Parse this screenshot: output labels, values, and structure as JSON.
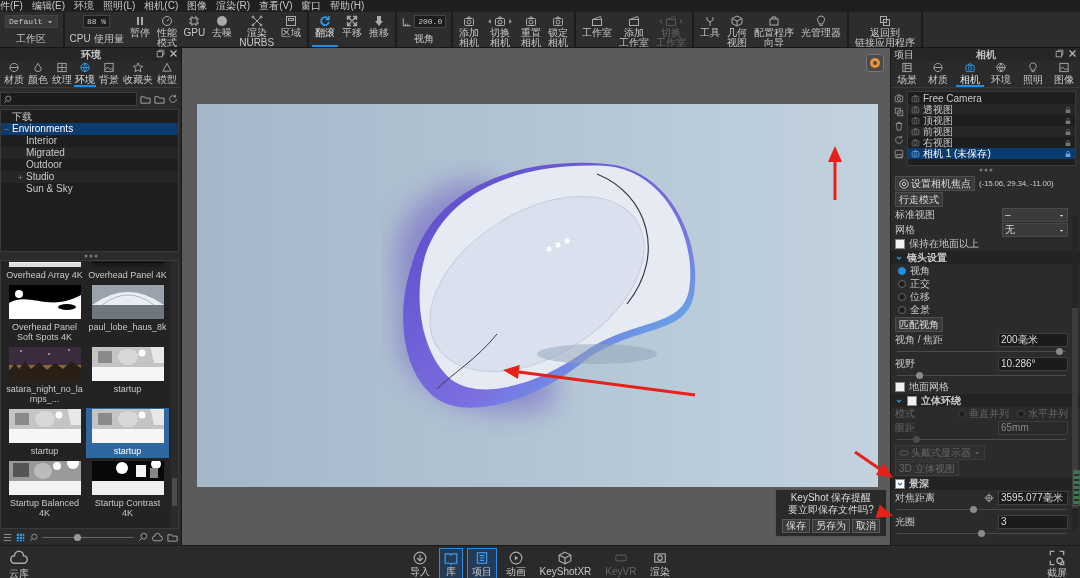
{
  "menu_bar": [
    "件(F)",
    "编辑(E)",
    "环境",
    "照明(L)",
    "相机(C)",
    "图像",
    "渲染(R)",
    "查看(V)",
    "窗口",
    "帮助(H)"
  ],
  "toolbar": {
    "groups": [
      [
        {
          "kind": "dropdown",
          "value": "Default",
          "label": "工作区"
        }
      ],
      [
        {
          "kind": "field",
          "value": "88 %",
          "label": "CPU 使用量"
        },
        {
          "kind": "button",
          "label": [
            "暂停"
          ]
        },
        {
          "kind": "button",
          "label": [
            "性能",
            "模式"
          ]
        },
        {
          "kind": "button",
          "label": [
            "GPU"
          ]
        },
        {
          "kind": "button",
          "label": [
            "去噪"
          ]
        },
        {
          "kind": "button",
          "label": [
            "渲染",
            "NURBS"
          ]
        },
        {
          "kind": "button",
          "label": [
            "区域"
          ]
        }
      ],
      [
        {
          "kind": "button",
          "label": [
            "翻滚"
          ],
          "selected": true
        },
        {
          "kind": "button",
          "label": [
            "平移"
          ],
          "selected": false
        },
        {
          "kind": "button",
          "label": [
            "推移"
          ],
          "selected": false
        }
      ],
      [
        {
          "kind": "field",
          "value": "200.0",
          "label": "视角"
        }
      ],
      [
        {
          "kind": "button",
          "label": [
            "添加",
            "相机"
          ]
        },
        {
          "kind": "switch",
          "label": [
            "切换",
            "相机"
          ]
        },
        {
          "kind": "button",
          "label": [
            "重置",
            "相机"
          ]
        },
        {
          "kind": "button",
          "label": [
            "锁定",
            "相机"
          ]
        }
      ],
      [
        {
          "kind": "button",
          "label": [
            "工作室"
          ],
          "disabled": false
        },
        {
          "kind": "button",
          "label": [
            "添加",
            "工作室"
          ],
          "disabled": false
        },
        {
          "kind": "switch",
          "label": [
            "切换",
            "工作室"
          ],
          "disabled": true
        }
      ],
      [
        {
          "kind": "button",
          "label": [
            "工具"
          ]
        },
        {
          "kind": "button",
          "label": [
            "几何",
            "视图"
          ]
        },
        {
          "kind": "button",
          "label": [
            "配置程序",
            "向导"
          ]
        },
        {
          "kind": "button",
          "label": [
            "光管理器"
          ]
        }
      ],
      [
        {
          "kind": "button",
          "label": [
            "返回到",
            "链接应用程序"
          ]
        }
      ]
    ]
  },
  "library": {
    "title": "环境",
    "tabs": [
      {
        "label": "材质",
        "selected": false
      },
      {
        "label": "颜色",
        "selected": false
      },
      {
        "label": "纹理",
        "selected": false
      },
      {
        "label": "环境",
        "selected": true
      },
      {
        "label": "背景",
        "selected": false
      },
      {
        "label": "收藏夹",
        "selected": false
      },
      {
        "label": "模型",
        "selected": false
      }
    ],
    "tree": [
      {
        "label": "下载",
        "selected": false
      },
      {
        "label": "Environments",
        "selected": true,
        "expanded": true,
        "children": [
          {
            "label": "Interior",
            "selected": false
          },
          {
            "label": "Migrated",
            "selected": false
          },
          {
            "label": "Outdoor",
            "selected": false
          },
          {
            "label": "Studio",
            "selected": false,
            "expanded": false
          },
          {
            "label": "Sun & Sky",
            "selected": false
          }
        ]
      }
    ],
    "thumbnails": [
      {
        "label": "Overhead Array 4K",
        "selected": false
      },
      {
        "label": "Overhead Panel 4K",
        "selected": false
      },
      {
        "label": "Overhead Panel Soft Spots 4K",
        "selected": false
      },
      {
        "label": "paul_lobe_haus_8k",
        "selected": false
      },
      {
        "label": "satara_night_no_lamps_...",
        "selected": false
      },
      {
        "label": "startup",
        "selected": false
      },
      {
        "label": "startup",
        "selected": false
      },
      {
        "label": "startup",
        "selected": true
      },
      {
        "label": "Startup Balanced 4K",
        "selected": false
      },
      {
        "label": "Startup Contrast 4K",
        "selected": false
      }
    ],
    "size_slider": {
      "level": 0.38
    }
  },
  "dialog": {
    "title": "KeyShot 保存提醒",
    "message": "要立即保存文件吗?",
    "buttons": [
      "保存",
      "另存为",
      "取消"
    ]
  },
  "project": {
    "panel_title": "项目",
    "title": "相机",
    "tabs": [
      {
        "label": "场景",
        "selected": false
      },
      {
        "label": "材质",
        "selected": false
      },
      {
        "label": "相机",
        "selected": true
      },
      {
        "label": "环境",
        "selected": false
      },
      {
        "label": "照明",
        "selected": false
      },
      {
        "label": "图像",
        "selected": false
      }
    ],
    "cameras": [
      {
        "label": "Free Camera",
        "selected": false,
        "locked": false
      },
      {
        "label": "透视图",
        "selected": false,
        "locked": true
      },
      {
        "label": "顶视图",
        "selected": false,
        "locked": true
      },
      {
        "label": "前视图",
        "selected": false,
        "locked": true
      },
      {
        "label": "右视图",
        "selected": false,
        "locked": true
      },
      {
        "label": "相机 1 (未保存)",
        "selected": true,
        "locked": true
      }
    ],
    "properties": [
      {
        "kind": "button",
        "label": "设置相机焦点",
        "note": "(-15.06, 29.34, -11.00)",
        "disabled": false
      },
      {
        "kind": "button",
        "label": "行走模式",
        "disabled": false
      },
      {
        "kind": "dropdown",
        "label": "标准视图",
        "value": "–"
      },
      {
        "kind": "dropdown",
        "label": "网格",
        "value": "无"
      },
      {
        "kind": "checkbox",
        "label": "保持在地面以上",
        "checked": false
      },
      {
        "kind": "section",
        "label": "镜头设置",
        "expanded": true
      },
      {
        "kind": "radio_group",
        "options": [
          {
            "label": "视角",
            "selected": true
          },
          {
            "label": "正交",
            "selected": false
          },
          {
            "label": "位移",
            "selected": false
          },
          {
            "label": "全景",
            "selected": false
          }
        ]
      },
      {
        "kind": "button",
        "label": "匹配视角",
        "disabled": false
      },
      {
        "kind": "slider",
        "label": "视角 / 焦距",
        "value": "200毫米",
        "level": 0.98,
        "disabled": false
      },
      {
        "kind": "slider",
        "label": "视野",
        "value": "10.286°",
        "level": 0.12,
        "disabled": false
      },
      {
        "kind": "checkbox",
        "label": "地面网格",
        "checked": false
      },
      {
        "kind": "section",
        "label": "立体环绕",
        "expanded": true,
        "checked": false
      },
      {
        "kind": "radio_row",
        "label": "模式",
        "disabled": true,
        "options": [
          {
            "label": "垂直并列",
            "selected": false
          },
          {
            "label": "水平并列",
            "selected": false
          }
        ]
      },
      {
        "kind": "slider",
        "label": "眼距",
        "value": "65mm",
        "level": 0.1,
        "disabled": true
      },
      {
        "kind": "dropdown_button",
        "label": "头戴式显示器",
        "disabled": true
      },
      {
        "kind": "button",
        "label": "3D 立体视图",
        "disabled": true
      },
      {
        "kind": "section",
        "label": "景深",
        "checked": true
      },
      {
        "kind": "focus_slider",
        "label": "对焦距离",
        "value": "3595.077毫米",
        "level": 0.45,
        "disabled": false
      },
      {
        "kind": "slider",
        "label": "光圈",
        "value": "3",
        "level": 0.5,
        "disabled": false
      }
    ]
  },
  "dock": {
    "left": "云库",
    "tabs": [
      {
        "label": "导入",
        "selected": false,
        "disabled": false
      },
      {
        "label": "库",
        "selected": true,
        "disabled": false
      },
      {
        "label": "项目",
        "selected": true,
        "disabled": false
      },
      {
        "label": "动画",
        "selected": false,
        "disabled": false
      },
      {
        "label": "KeyShotXR",
        "selected": false,
        "disabled": false
      },
      {
        "label": "KeyVR",
        "selected": false,
        "disabled": true
      },
      {
        "label": "渲染",
        "selected": false,
        "disabled": false
      }
    ],
    "right": "截屏"
  }
}
